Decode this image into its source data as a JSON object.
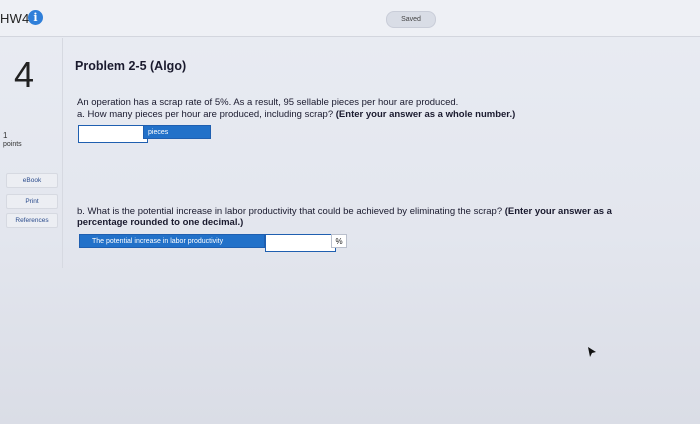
{
  "header": {
    "assignment_title": "HW4",
    "info_icon": "info-icon",
    "status": "Saved"
  },
  "question": {
    "number": "4",
    "points_value": "1",
    "points_label": "points"
  },
  "sidebar": {
    "items": [
      {
        "label": "eBook"
      },
      {
        "label": "Print"
      },
      {
        "label": "References"
      }
    ]
  },
  "problem": {
    "title": "Problem 2-5 (Algo)",
    "statement": "An operation has a scrap rate of 5%. As a result, 95 sellable pieces per hour are produced.",
    "part_a": {
      "prefix": "a. How many pieces per hour are produced, including scrap?",
      "instruction": "(Enter your answer as a whole number.)",
      "input_value": "",
      "unit_label": "pieces"
    },
    "part_b": {
      "prefix": "b. What is the potential increase in labor productivity that could be achieved by eliminating the scrap?",
      "instruction_line1": "(Enter your answer as a",
      "instruction_line2": "percentage rounded to one decimal.)",
      "field_label": "The potential increase in labor productivity",
      "input_value": "",
      "unit_label": "%"
    }
  },
  "colors": {
    "accent_blue": "#2271c9",
    "info_blue": "#2f7fd9"
  }
}
